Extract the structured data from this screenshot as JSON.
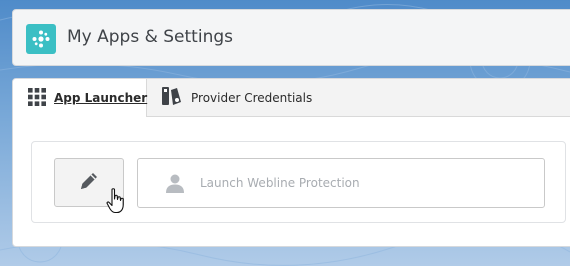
{
  "header": {
    "title": "My Apps & Settings",
    "icon": "app-dots-icon",
    "icon_color": "#3bbfc4"
  },
  "tabs": [
    {
      "label": "App Launcher",
      "icon": "grid-icon",
      "active": true
    },
    {
      "label": "Provider Credentials",
      "icon": "credentials-icon",
      "active": false
    }
  ],
  "launcher": {
    "edit_icon": "pencil-icon",
    "app_tile_label": "Launch Webline Protection",
    "app_tile_icon": "user-icon"
  },
  "colors": {
    "background_top": "#4f8bc9",
    "card_border": "#d6d9dd",
    "placeholder_text": "#a8acb1"
  }
}
